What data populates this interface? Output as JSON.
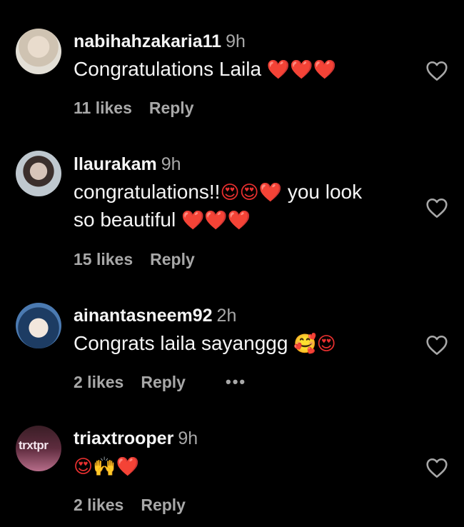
{
  "comments": [
    {
      "username": "nabihahzakaria11",
      "time": "9h",
      "line1": "Congratulations Laila ",
      "emojis1": "❤️❤️❤️",
      "line2": "",
      "emojis2": "",
      "likes": "11 likes",
      "reply": "Reply"
    },
    {
      "username": "llaurakam",
      "time": "9h",
      "line1": "congratulations!!",
      "emojis1": "😍😍❤️",
      "line1b": " you look",
      "line2": "so beautiful ",
      "emojis2": "❤️❤️❤️",
      "likes": "15 likes",
      "reply": "Reply"
    },
    {
      "username": "ainantasneem92",
      "time": "2h",
      "line1": "Congrats laila sayanggg ",
      "emojis1": "🥰😍",
      "likes": "2 likes",
      "reply": "Reply",
      "more": "•••"
    },
    {
      "username": "triaxtrooper",
      "time": "9h",
      "line1": "",
      "emojis1": "😍🙌❤️",
      "likes": "2 likes",
      "reply": "Reply",
      "avatar_text": "trxtpr"
    }
  ],
  "icons": {
    "like": "heart-outline-icon"
  },
  "colors": {
    "background": "#000000",
    "primary_text": "#f5f5f5",
    "secondary_text": "#a8a8a8"
  }
}
